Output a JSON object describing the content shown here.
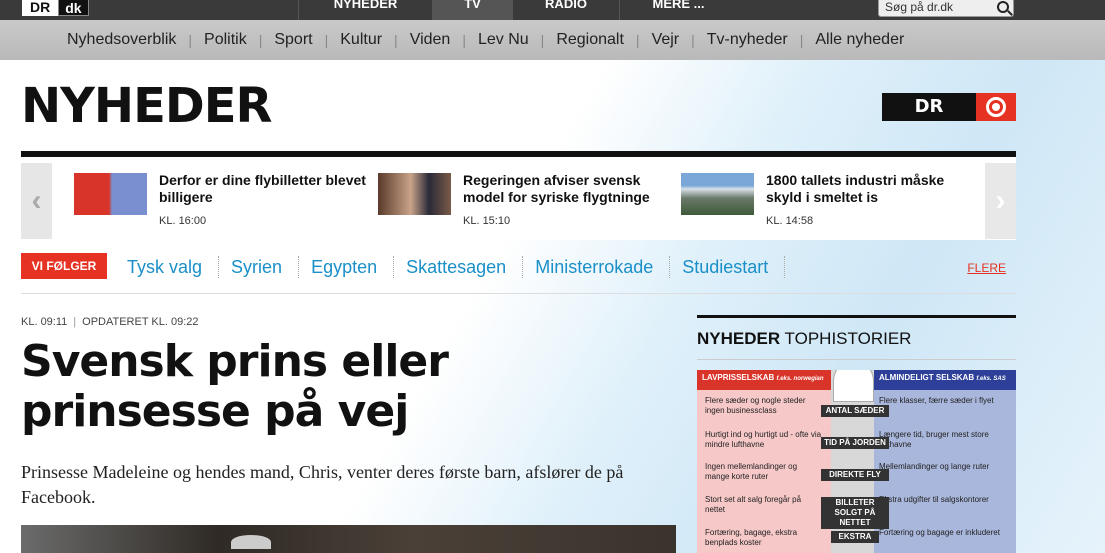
{
  "topbar": {
    "logo_dr": "DR",
    "logo_dk": "dk",
    "nav": [
      "NYHEDER",
      "TV",
      "RADIO",
      "MERE ..."
    ],
    "search_placeholder": "Søg på dr.dk"
  },
  "subnav": [
    "Nyhedsoverblik",
    "Politik",
    "Sport",
    "Kultur",
    "Viden",
    "Lev Nu",
    "Regionalt",
    "Vejr",
    "Tv-nyheder",
    "Alle nyheder"
  ],
  "page_title": "NYHEDER",
  "badge": "DR",
  "carousel": [
    {
      "title": "Derfor er dine flybilletter blevet billigere",
      "time": "KL. 16:00"
    },
    {
      "title": "Regeringen afviser svensk model for syriske flygtninge",
      "time": "KL. 15:10"
    },
    {
      "title": "1800 tallets industri måske skyld i smeltet is",
      "time": "KL. 14:58"
    }
  ],
  "follow": {
    "label": "VI FØLGER",
    "links": [
      "Tysk valg",
      "Syrien",
      "Egypten",
      "Skattesagen",
      "Ministerrokade",
      "Studiestart"
    ],
    "more": "FLERE"
  },
  "article": {
    "time": "KL. 09:11",
    "updated": "OPDATERET KL. 09:22",
    "headline": "Svensk prins eller prinsesse på vej",
    "lead": "Prinsesse Madeleine og hendes mand, Chris, venter deres første barn, afslører de på Facebook."
  },
  "sidebar": {
    "head_bold": "NYHEDER",
    "head_rest": " TOPHISTORIER",
    "infographic": {
      "left_head": "LAVPRISSELSKAB",
      "left_sub": "f.eks. norwegian",
      "right_head": "ALMINDELIGT SELSKAB",
      "right_sub": "f.eks. SAS",
      "labels": [
        "ANTAL SÆDER",
        "TID PÅ JORDEN",
        "DIREKTE FLY",
        "BILLETER SOLGT PÅ NETTET",
        "EKSTRA"
      ],
      "left": [
        "Flere sæder og nogle steder ingen businessclass",
        "Hurtigt ind og hurtigt ud - ofte via mindre lufthavne",
        "Ingen mellemlandinger og mange korte ruter",
        "Stort set alt salg foregår på nettet",
        "Fortæring, bagage, ekstra benplads koster"
      ],
      "right": [
        "Flere klasser, færre sæder i flyet",
        "Længere tid, bruger mest store lufthavne",
        "Mellemlandinger og lange ruter",
        "Ekstra udgifter til salgskontorer",
        "Fortæring og bagage er inkluderet"
      ]
    }
  }
}
